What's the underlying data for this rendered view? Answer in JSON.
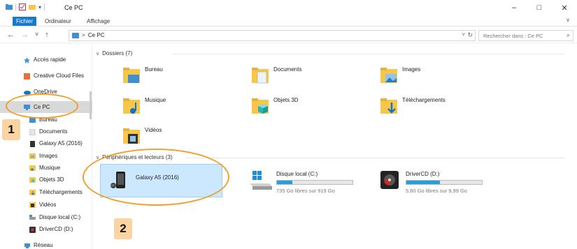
{
  "window": {
    "title": "Ce PC",
    "qa_arrow": "▾"
  },
  "ribbon": {
    "tabs": [
      "Fichier",
      "Ordinateur",
      "Affichage"
    ],
    "expand": "∨"
  },
  "address": {
    "back": "←",
    "forward": "→",
    "recent": "˅",
    "up": "↑",
    "path_sep": ">",
    "path_location": "Ce PC",
    "dropdown": "˅",
    "refresh": "↻",
    "search_placeholder": "Rechercher dans : Ce PC",
    "search_icon": "⌕"
  },
  "sidebar": {
    "items": [
      {
        "label": "Accès rapide",
        "icon": "star-icon"
      },
      {
        "label": "Creative Cloud Files",
        "icon": "creative-cloud-icon"
      },
      {
        "label": "OneDrive",
        "icon": "cloud-icon"
      },
      {
        "label": "Ce PC",
        "icon": "computer-icon",
        "selected": true
      },
      {
        "label": "Bureau",
        "icon": "desktop-folder-icon"
      },
      {
        "label": "Documents",
        "icon": "documents-folder-icon"
      },
      {
        "label": "Galaxy A5 (2016)",
        "icon": "phone-icon"
      },
      {
        "label": "Images",
        "icon": "images-folder-icon"
      },
      {
        "label": "Musique",
        "icon": "music-folder-icon"
      },
      {
        "label": "Objets 3D",
        "icon": "objects3d-folder-icon"
      },
      {
        "label": "Téléchargements",
        "icon": "downloads-folder-icon"
      },
      {
        "label": "Vidéos",
        "icon": "videos-folder-icon"
      },
      {
        "label": "Disque local (C:)",
        "icon": "disk-icon"
      },
      {
        "label": "DriverCD (D:)",
        "icon": "cd-drive-icon"
      },
      {
        "label": "Réseau",
        "icon": "network-icon"
      }
    ]
  },
  "content": {
    "folders_group": "Dossiers (7)",
    "folders": [
      {
        "label": "Bureau",
        "icon": "desktop-folder-icon"
      },
      {
        "label": "Documents",
        "icon": "documents-folder-icon"
      },
      {
        "label": "Images",
        "icon": "images-folder-icon"
      },
      {
        "label": "Musique",
        "icon": "music-folder-icon"
      },
      {
        "label": "Objets 3D",
        "icon": "objects3d-folder-icon"
      },
      {
        "label": "Téléchargements",
        "icon": "downloads-folder-icon"
      },
      {
        "label": "Vidéos",
        "icon": "videos-folder-icon"
      }
    ],
    "devices_group": "Périphériques et lecteurs (3)",
    "devices": [
      {
        "label": "Galaxy A5 (2016)",
        "icon": "phone-icon",
        "selected": true
      },
      {
        "label": "Disque local (C:)",
        "icon": "windows-disk-icon",
        "usage_fraction": 0.2,
        "size_text": "735 Go libres sur 919 Go"
      },
      {
        "label": "DriverCD (D:)",
        "icon": "cd-drive-icon",
        "usage_fraction": 0.44,
        "size_text": "5,60 Go libres sur 9,99 Go"
      }
    ]
  },
  "annotations": {
    "badge1": "1",
    "badge2": "2"
  },
  "colors": {
    "accent": "#1979ca",
    "selection": "#cce8ff",
    "annotation": "#f0a030",
    "badge": "#fbd4a2",
    "folder": "#f8c74a"
  }
}
